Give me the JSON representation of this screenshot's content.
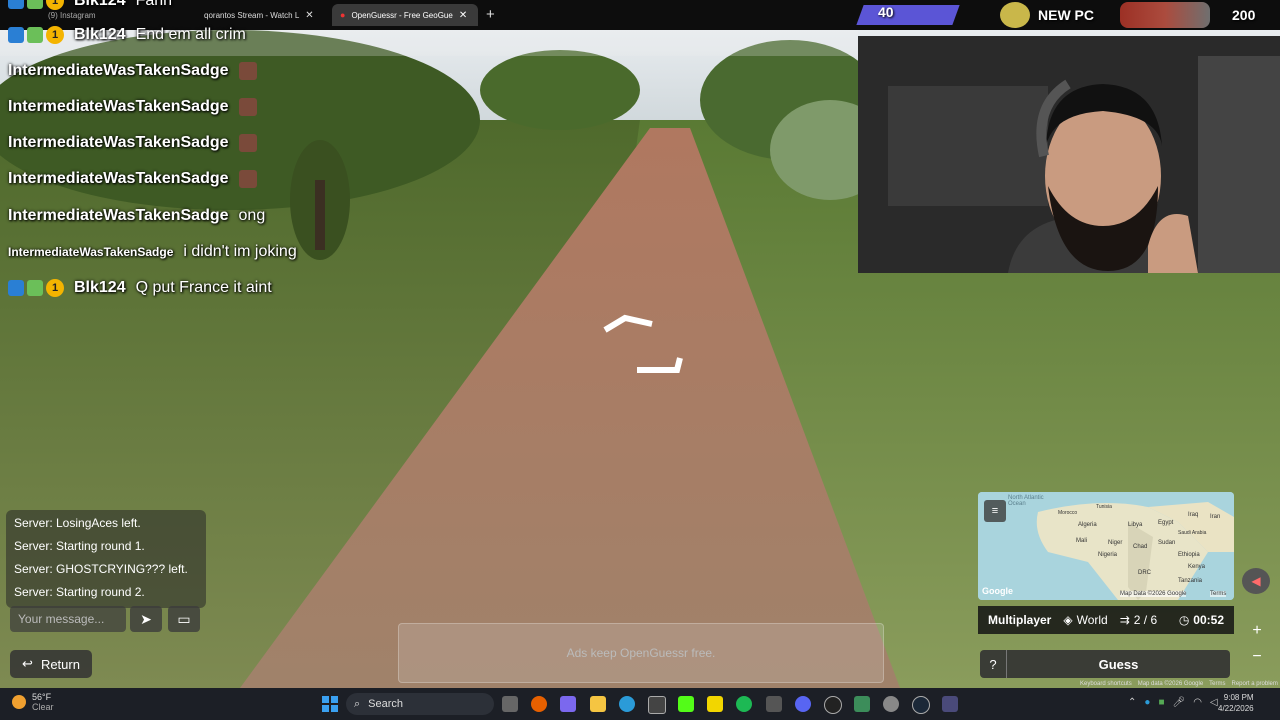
{
  "browser": {
    "tabs": [
      {
        "label": "(9) Instagram"
      },
      {
        "label": "qorantos Stream - Watch L"
      },
      {
        "label": "OpenGuessr - Free GeoGue"
      }
    ],
    "new_tab_icon": "plus-icon"
  },
  "stream_overlay": {
    "counter_value": "40",
    "new_pc_label": "NEW PC",
    "goal_value": "200"
  },
  "chat": [
    {
      "user": "Blk124",
      "message": "Fahh",
      "badges": true
    },
    {
      "user": "Blk124",
      "message": "End em all crim",
      "badges": true
    },
    {
      "user": "IntermediateWasTakenSadge",
      "message": "",
      "emote": true
    },
    {
      "user": "IntermediateWasTakenSadge",
      "message": "",
      "emote": true
    },
    {
      "user": "IntermediateWasTakenSadge",
      "message": "",
      "emote": true
    },
    {
      "user": "IntermediateWasTakenSadge",
      "message": "",
      "emote": true
    },
    {
      "user": "IntermediateWasTakenSadge",
      "message": "ong"
    },
    {
      "user": "IntermediateWasTakenSadge",
      "message": "i didn't im joking",
      "small_name": true
    },
    {
      "user": "Blk124",
      "message": "Q put France it aint",
      "badges": true
    }
  ],
  "game": {
    "server_messages": [
      "Server: LosingAces left.",
      "Server: Starting round 1.",
      "Server: GHOSTCRYING??? left.",
      "Server: Starting round 2."
    ],
    "message_placeholder": "Your message...",
    "return_label": "Return",
    "ad_text": "Ads keep OpenGuessr free.",
    "mode_label": "Multiplayer",
    "map_label": "World",
    "round_label": "2 / 6",
    "timer": "00:52",
    "guess_label": "Guess",
    "help_label": "?",
    "map_attribution": "Map Data ©2026 Google",
    "terms_label": "Terms",
    "bottom_credits": [
      "Keyboard shortcuts",
      "Map data ©2026 Google",
      "Terms",
      "Report a problem"
    ],
    "map_labels": [
      "North Atlantic Ocean",
      "Tunisia",
      "Morocco",
      "Algeria",
      "Libya",
      "Egypt",
      "Iraq",
      "Iran",
      "Saudi Arabia",
      "Mali",
      "Niger",
      "Chad",
      "Sudan",
      "Nigeria",
      "Ethiopia",
      "DRC",
      "Kenya",
      "Tanzania",
      "Google"
    ]
  },
  "taskbar": {
    "weather_temp": "56°F",
    "weather_desc": "Clear",
    "search_label": "Search",
    "time": "9:08 PM",
    "date": "4/22/2026"
  },
  "colors": {
    "tab_active": "#3a3a3a",
    "overlay_purple": "#5b55d6",
    "coin": "#f4b400"
  }
}
